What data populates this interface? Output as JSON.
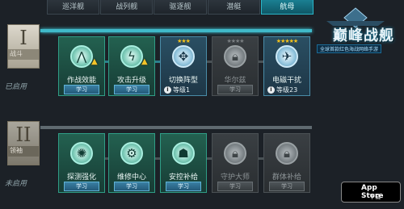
{
  "tabs": [
    "巡洋舰",
    "战列舰",
    "驱逐舰",
    "潜艇",
    "航母"
  ],
  "active_tab": 4,
  "logo": {
    "title": "巅峰战舰",
    "subtitle": "全球首款红色海战网络手游"
  },
  "section1": {
    "numeral": "I",
    "label": "战斗",
    "status": "已启用",
    "cards": [
      {
        "name": "作战效能",
        "stars": "",
        "button": "学习",
        "level": ""
      },
      {
        "name": "攻击升级",
        "stars": "",
        "button": "学习",
        "level": ""
      },
      {
        "name": "切换阵型",
        "stars": "★★★",
        "button": "",
        "level": "等级1"
      },
      {
        "name": "华尔兹",
        "stars": "★★★★",
        "button": "学习",
        "level": ""
      },
      {
        "name": "电磁干扰",
        "stars": "★★★★★",
        "button": "",
        "level": "等级23"
      }
    ]
  },
  "section2": {
    "numeral": "II",
    "label": "领袖",
    "status": "未启用",
    "cards": [
      {
        "name": "探测强化",
        "stars": "",
        "button": "学习"
      },
      {
        "name": "维修中心",
        "stars": "",
        "button": "学习"
      },
      {
        "name": "安控补给",
        "stars": "",
        "button": "学习"
      },
      {
        "name": "守护大师",
        "stars": "",
        "button": "学习"
      },
      {
        "name": "群体补给",
        "stars": "",
        "button": "学习"
      }
    ]
  },
  "appstore": {
    "line1": "App Store",
    "line2": "下载"
  },
  "info_glyph": "i",
  "colors": {
    "accent": "#1a7f92",
    "star": "#f4c21a",
    "active_card": "#236150"
  }
}
